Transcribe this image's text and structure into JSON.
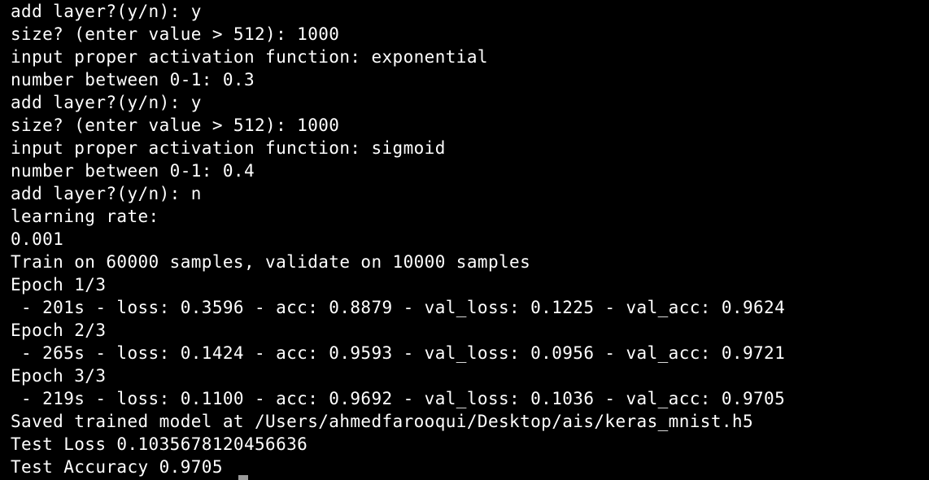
{
  "terminal": {
    "lines": [
      "add layer?(y/n): y",
      "size? (enter value > 512): 1000",
      "input proper activation function: exponential",
      "number between 0-1: 0.3",
      "add layer?(y/n): y",
      "size? (enter value > 512): 1000",
      "input proper activation function: sigmoid",
      "number between 0-1: 0.4",
      "add layer?(y/n): n",
      "learning rate:",
      "0.001",
      "Train on 60000 samples, validate on 10000 samples",
      "Epoch 1/3",
      " - 201s - loss: 0.3596 - acc: 0.8879 - val_loss: 0.1225 - val_acc: 0.9624",
      "Epoch 2/3",
      " - 265s - loss: 0.1424 - acc: 0.9593 - val_loss: 0.0956 - val_acc: 0.9721",
      "Epoch 3/3",
      " - 219s - loss: 0.1100 - acc: 0.9692 - val_loss: 0.1036 - val_acc: 0.9705",
      "Saved trained model at /Users/ahmedfarooqui/Desktop/ais/keras_mnist.h5",
      "Test Loss 0.1035678120456636",
      "Test Accuracy 0.9705"
    ]
  },
  "colors": {
    "background": "#000000",
    "text": "#ffffff",
    "cursor": "#9a9a9a"
  }
}
